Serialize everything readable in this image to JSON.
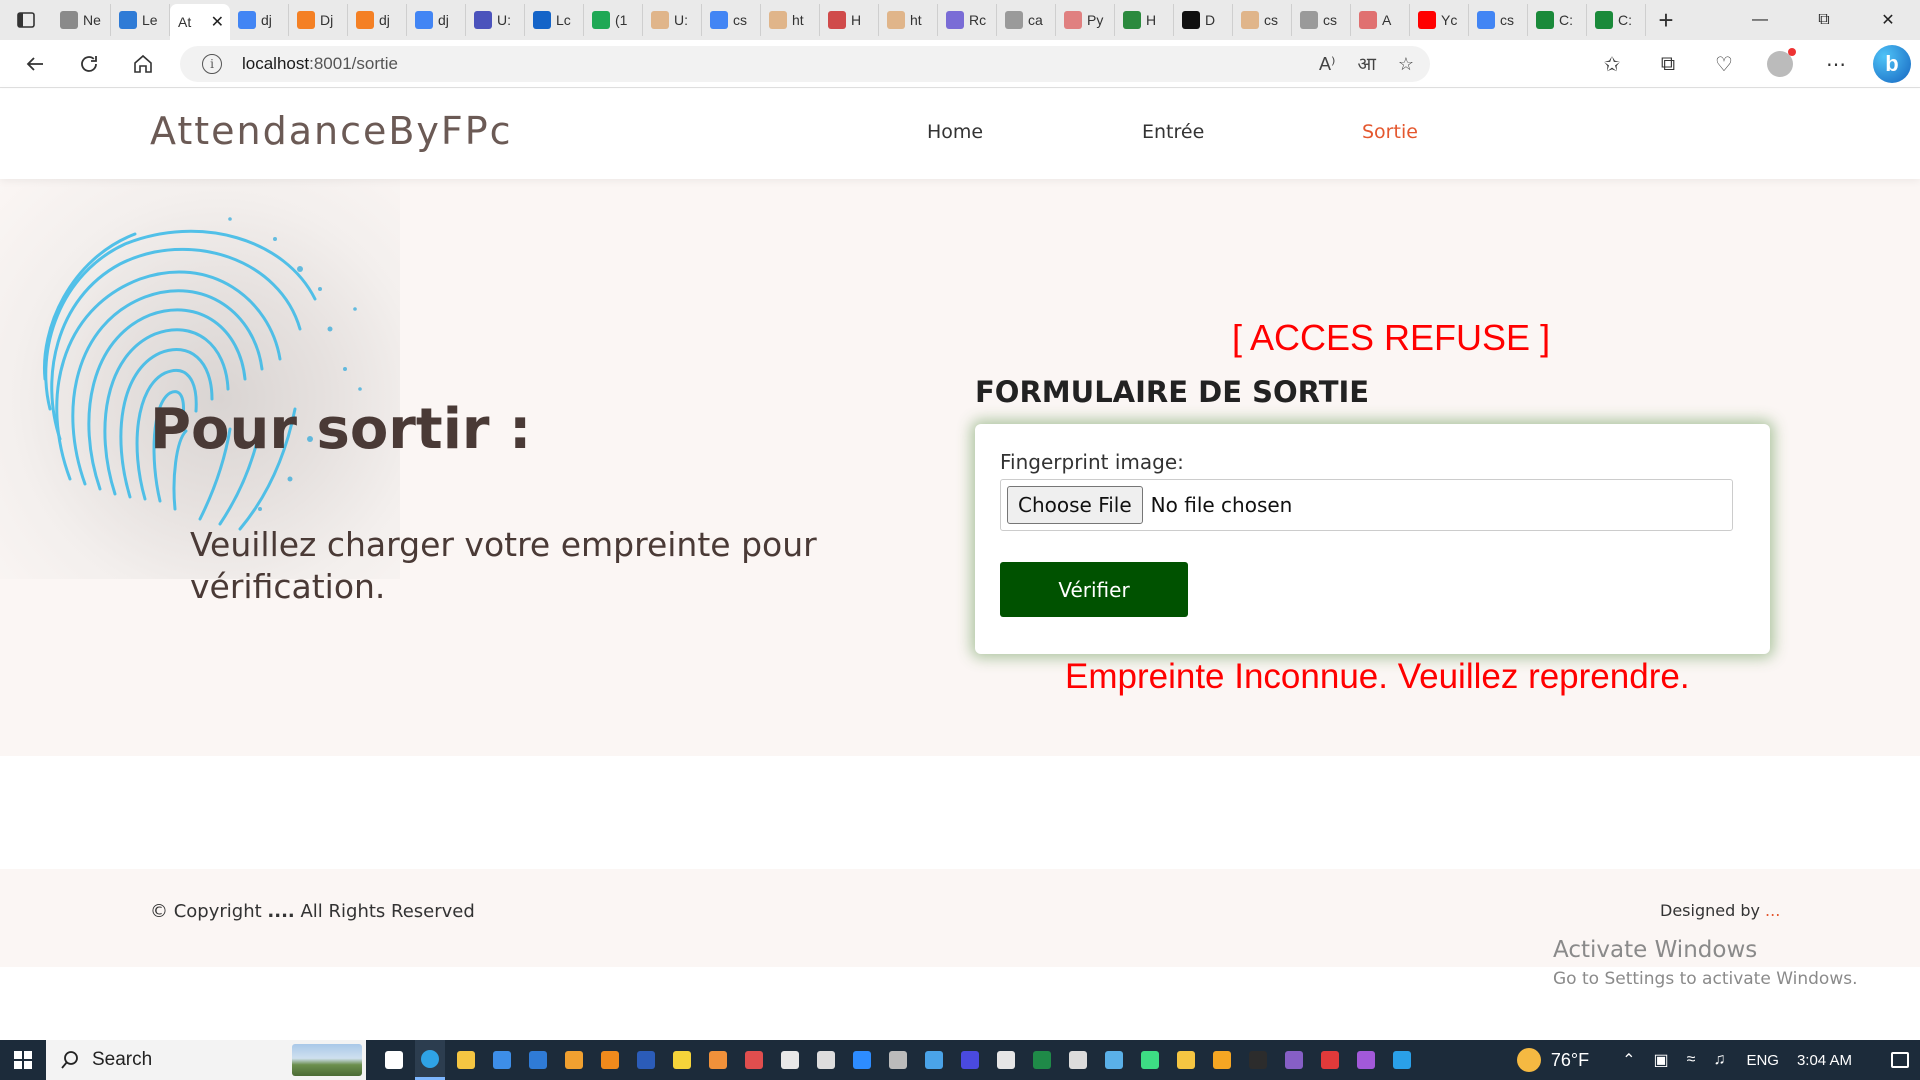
{
  "browser": {
    "tabs": [
      {
        "label": "Ne",
        "icon": "page-icon",
        "color": "#8a8a8a"
      },
      {
        "label": "Le",
        "icon": "microsoft-icon",
        "color": "#2f7bd6"
      },
      {
        "label": "At",
        "icon": "",
        "color": "#ffffff",
        "active": true
      },
      {
        "label": "dj",
        "icon": "google-icon",
        "color": "#4285f4"
      },
      {
        "label": "Dj",
        "icon": "stackoverflow-icon",
        "color": "#f48024"
      },
      {
        "label": "dj",
        "icon": "stackoverflow-icon",
        "color": "#f48024"
      },
      {
        "label": "dj",
        "icon": "google-icon",
        "color": "#4285f4"
      },
      {
        "label": "U:",
        "icon": "teams-icon",
        "color": "#4b53bc"
      },
      {
        "label": "Lc",
        "icon": "cfe-icon",
        "color": "#1464c8"
      },
      {
        "label": "(1",
        "icon": "whatsapp-icon",
        "color": "#1fa855"
      },
      {
        "label": "U:",
        "icon": "stackoverflow-icon",
        "color": "#e0b58a"
      },
      {
        "label": "cs",
        "icon": "google-icon",
        "color": "#4285f4"
      },
      {
        "label": "ht",
        "icon": "stackoverflow-icon",
        "color": "#e0b58a"
      },
      {
        "label": "H",
        "icon": "flower-icon",
        "color": "#d04a4a"
      },
      {
        "label": "ht",
        "icon": "stackoverflow-icon",
        "color": "#e0b58a"
      },
      {
        "label": "Rc",
        "icon": "colorful-icon",
        "color": "#7a6cd6"
      },
      {
        "label": "ca",
        "icon": "google-icon",
        "color": "#9a9a9a"
      },
      {
        "label": "Py",
        "icon": "pdf-icon",
        "color": "#e08080"
      },
      {
        "label": "H",
        "icon": "link-icon",
        "color": "#2b8a3e"
      },
      {
        "label": "D",
        "icon": "notion-icon",
        "color": "#111111"
      },
      {
        "label": "cs",
        "icon": "stackoverflow-icon",
        "color": "#e0b58a"
      },
      {
        "label": "cs",
        "icon": "google-icon",
        "color": "#9a9a9a"
      },
      {
        "label": "A",
        "icon": "asterisk-icon",
        "color": "#e07070"
      },
      {
        "label": "Yc",
        "icon": "youtube-icon",
        "color": "#ff0000"
      },
      {
        "label": "cs",
        "icon": "google-icon",
        "color": "#4285f4"
      },
      {
        "label": "C:",
        "icon": "w-icon",
        "color": "#1a8a3a"
      },
      {
        "label": "C:",
        "icon": "w-icon",
        "color": "#1a8a3a"
      }
    ],
    "address": {
      "host": "localhost",
      "rest": ":8001/sortie"
    }
  },
  "site": {
    "brand": "AttendanceByFPc",
    "nav": [
      {
        "label": "Home",
        "active": false
      },
      {
        "label": "Entrée",
        "active": false
      },
      {
        "label": "Sortie",
        "active": true
      }
    ],
    "accent": "#e4572e"
  },
  "hero": {
    "title": "Pour sortir :",
    "subtitle": "Veuillez charger votre empreinte pour vérification."
  },
  "form": {
    "status": "[ ACCES REFUSE ]",
    "heading": "FORMULAIRE DE SORTIE",
    "field_label": "Fingerprint image:",
    "choose_label": "Choose File",
    "file_status": "No file chosen",
    "submit_label": "Vérifier",
    "error": "Empreinte Inconnue. Veuillez reprendre.",
    "button_color": "#005200",
    "error_color": "#ff0000"
  },
  "footer": {
    "copyright_prefix": "© Copyright ",
    "copyright_bold": "....",
    "copyright_suffix": " All Rights Reserved",
    "designed_prefix": "Designed by ",
    "designed_link": "..."
  },
  "watermark": {
    "line1": "Activate Windows",
    "line2": "Go to Settings to activate Windows."
  },
  "taskbar": {
    "search_label": "Search",
    "weather": "76°F",
    "language": "ENG",
    "time": "3:04 AM"
  }
}
